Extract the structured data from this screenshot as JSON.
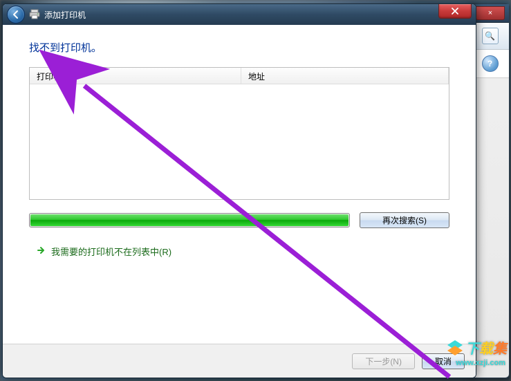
{
  "dialog": {
    "title": "添加打印机",
    "heading": "找不到打印机。",
    "columns": {
      "name": "打印机名称",
      "address": "地址"
    },
    "search_again": "再次搜索(S)",
    "not_listed": "我需要的打印机不在列表中(R)",
    "next": "下一步(N)",
    "cancel": "取消"
  },
  "icons": {
    "back": "back-arrow",
    "printer": "printer-icon",
    "close": "×",
    "link_arrow": "→"
  },
  "secondary": {
    "close": "×",
    "magnifier": "🔍",
    "help": "?"
  },
  "watermark": {
    "text_parts": [
      "下",
      "载",
      "集"
    ],
    "sub": "www.xzji.com"
  }
}
